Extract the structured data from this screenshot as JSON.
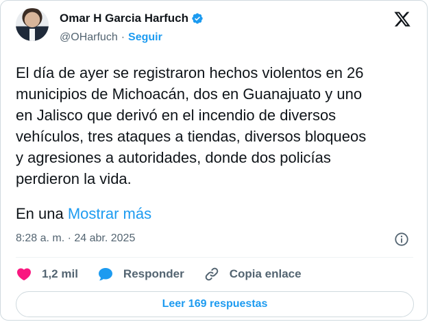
{
  "author": {
    "name": "Omar H Garcia Harfuch",
    "handle": "@OHarfuch",
    "separator": "·",
    "follow_label": "Seguir"
  },
  "tweet": {
    "text": "El día de ayer se registraron hechos violentos en 26\nmunicipios de Michoacán, dos en Guanajuato y uno\nen Jalisco que derivó en el incendio de diversos\nvehículos, tres ataques a tiendas, diversos bloqueos\ny agresiones a autoridades, donde dos policías\nperdieron la vida.",
    "truncated_prefix": "En una ",
    "show_more_label": "Mostrar más",
    "timestamp": "8:28 a. m. · 24 abr. 2025"
  },
  "actions": {
    "likes": "1,2 mil",
    "reply_label": "Responder",
    "copy_link_label": "Copia enlace"
  },
  "replies_button_label": "Leer 169 respuestas",
  "colors": {
    "accent": "#1d9bf0",
    "like": "#f91880",
    "text": "#0f1419",
    "muted": "#536471"
  },
  "icons": [
    "verified-badge-icon",
    "x-logo-icon",
    "info-icon",
    "heart-icon",
    "reply-bubble-icon",
    "link-icon"
  ]
}
